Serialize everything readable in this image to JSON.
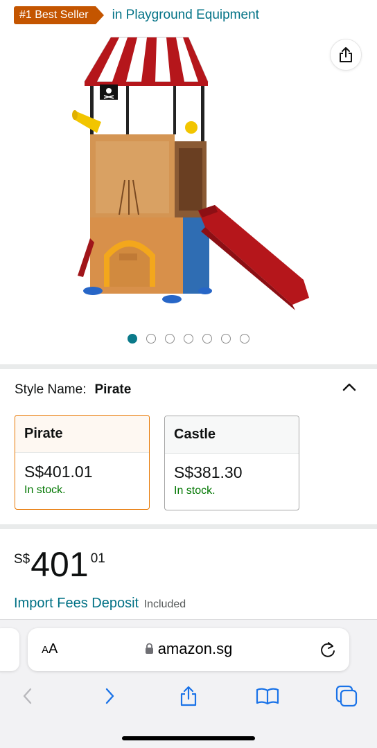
{
  "badge": {
    "label": "#1 Best Seller",
    "category": "in Playground Equipment"
  },
  "carousel": {
    "count": 7,
    "active": 0
  },
  "style": {
    "label": "Style Name:",
    "value": "Pirate",
    "options": [
      {
        "name": "Pirate",
        "price": "S$401.01",
        "stock": "In stock."
      },
      {
        "name": "Castle",
        "price": "S$381.30",
        "stock": "In stock."
      }
    ]
  },
  "price": {
    "symbol": "S$",
    "whole": "401",
    "fraction": "01"
  },
  "import": {
    "link": "Import Fees Deposit",
    "note": "Included"
  },
  "browser": {
    "aa_small": "A",
    "aa_large": "A",
    "url": "amazon.sg"
  },
  "icons": {
    "share": "share-icon",
    "collapse": "chevron-up-icon",
    "lock": "lock-icon",
    "reload": "reload-icon",
    "back": "chevron-left-icon",
    "forward": "chevron-right-icon",
    "bookmarks": "book-icon",
    "tabs": "tabs-icon"
  },
  "colors": {
    "badge": "#c45500",
    "link": "#007185",
    "stock": "#007600",
    "selected_border": "#e77600",
    "dot_active": "#0b7a8a"
  }
}
